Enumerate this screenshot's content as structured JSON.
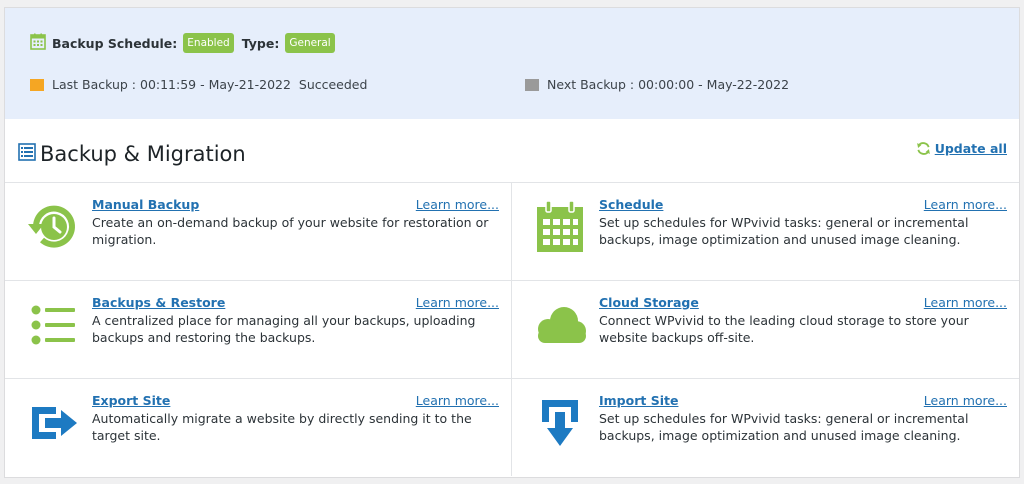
{
  "status": {
    "schedule_label": "Backup Schedule:",
    "schedule_badge": "Enabled",
    "type_label": "Type:",
    "type_badge": "General",
    "last_backup": "Last Backup : 00:11:59 - May-21-2022  Succeeded",
    "next_backup": "Next Backup : 00:00:00 - May-22-2022"
  },
  "header": {
    "title": "Backup & Migration",
    "update_all": "Update all"
  },
  "colors": {
    "accent_green": "#8bc34a",
    "link_blue": "#2271b1",
    "icon_blue": "#1d7ac2",
    "folder_orange": "#f5a623"
  },
  "cards": [
    {
      "icon": "history-clock-icon",
      "title": "Manual Backup",
      "learn": "Learn more...",
      "desc": "Create an on-demand backup of your website for restoration or migration."
    },
    {
      "icon": "calendar-icon",
      "title": "Schedule",
      "learn": "Learn more...",
      "desc": "Set up schedules for WPvivid tasks: general or incremental backups, image optimization and unused image cleaning."
    },
    {
      "icon": "list-icon",
      "title": "Backups & Restore",
      "learn": "Learn more...",
      "desc": "A centralized place for managing all your backups, uploading backups and restoring the backups."
    },
    {
      "icon": "cloud-icon",
      "title": "Cloud Storage",
      "learn": "Learn more...",
      "desc": "Connect WPvivid to the leading cloud storage to store your website backups off-site."
    },
    {
      "icon": "export-icon",
      "title": "Export Site",
      "learn": "Learn more...",
      "desc": "Automatically migrate a website by directly sending it to the target site."
    },
    {
      "icon": "import-icon",
      "title": "Import Site",
      "learn": "Learn more...",
      "desc": "Set up schedules for WPvivid tasks: general or incremental backups, image optimization and unused image cleaning."
    }
  ]
}
